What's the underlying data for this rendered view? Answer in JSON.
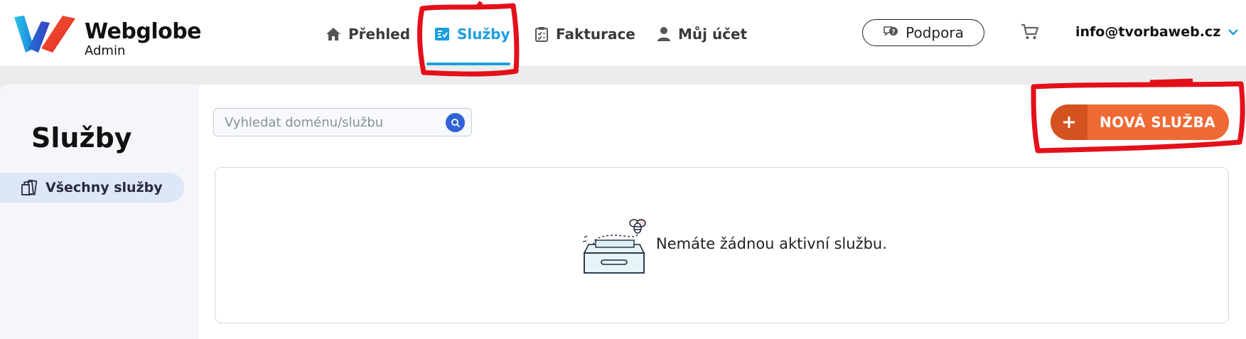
{
  "brand": {
    "name": "Webglobe",
    "sub": "Admin"
  },
  "nav": {
    "items": [
      {
        "label": "Přehled",
        "icon": "home-icon"
      },
      {
        "label": "Služby",
        "icon": "services-icon",
        "active": true
      },
      {
        "label": "Fakturace",
        "icon": "clipboard-icon"
      },
      {
        "label": "Můj účet",
        "icon": "user-icon"
      }
    ]
  },
  "header": {
    "support_label": "Podpora",
    "account_email": "info@tvorbaweb.cz"
  },
  "sidebar": {
    "title": "Služby",
    "items": [
      {
        "label": "Všechny služby",
        "icon": "services-stack-icon"
      }
    ]
  },
  "search": {
    "placeholder": "Vyhledat doménu/službu",
    "value": ""
  },
  "actions": {
    "new_service_label": "NOVÁ SLUŽBA"
  },
  "empty_state": {
    "message": "Nemáte žádnou aktivní službu."
  },
  "colors": {
    "accent": "#1b9fe0",
    "primary_button": "#ef6a35",
    "primary_button_dark": "#d4521f",
    "annotation": "#e3101a"
  }
}
